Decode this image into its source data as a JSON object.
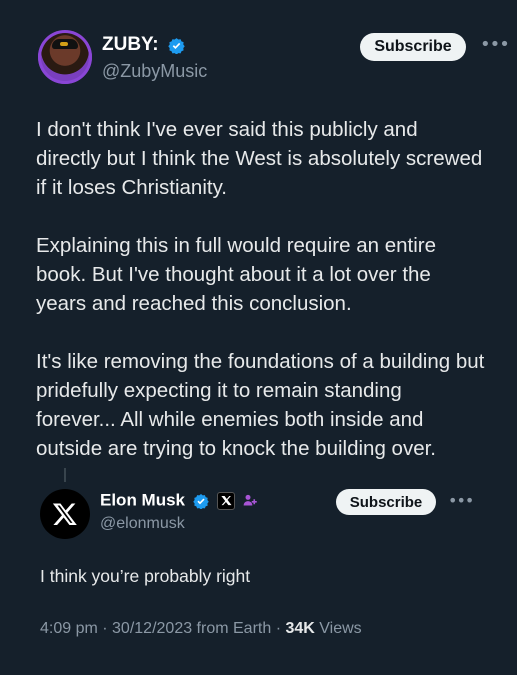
{
  "author": {
    "display_name": "ZUBY:",
    "handle": "@ZubyMusic",
    "subscribe_label": "Subscribe"
  },
  "tweet": {
    "paragraphs": [
      "I don't think I've ever said this publicly and directly but I think the West is absolutely screwed if it loses Christianity.",
      "Explaining this in full would require an entire book. But I've thought about it a lot over the years and reached this conclusion.",
      "It's like removing the foundations of a building but pridefully expecting it to remain standing forever... All while enemies both inside and outside are trying to knock the building over."
    ]
  },
  "reply": {
    "display_name": "Elon Musk",
    "handle": "@elonmusk",
    "subscribe_label": "Subscribe",
    "text": "I think you’re probably right",
    "meta_prefix": "4:09 pm · 30/12/2023 from Earth · ",
    "views_count": "34K",
    "views_label": " Views"
  },
  "colors": {
    "background": "#15202b",
    "verified_blue": "#1d9bf0",
    "affiliate_purple": "#a855d6",
    "secondary_text": "#8b98a5"
  },
  "icons": [
    "verified-badge-icon",
    "x-logo-icon",
    "affiliate-badge-icon",
    "more-options-icon"
  ]
}
